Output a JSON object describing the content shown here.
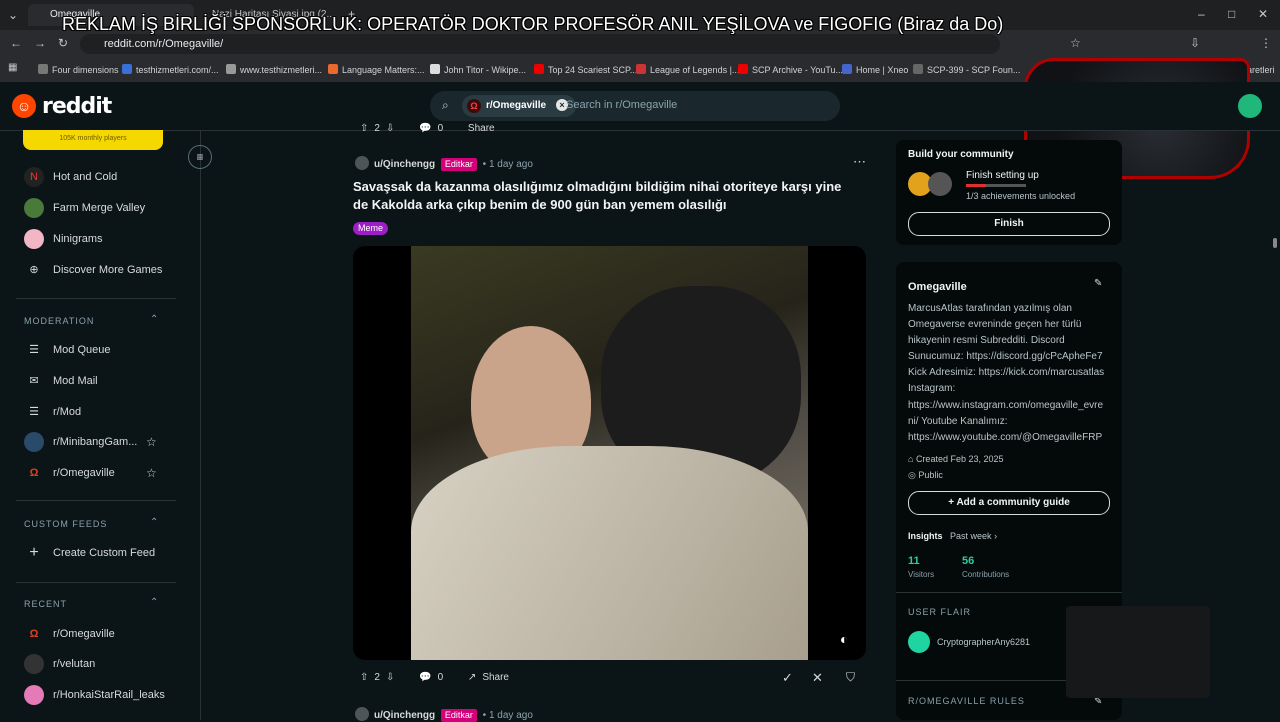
{
  "browser": {
    "tabs": [
      {
        "label": "Omegaville",
        "active": true
      },
      {
        "label": "Nazi Haritası Siyasi.jpg (2...",
        "active": false
      }
    ],
    "overlay_title": "REKLAM İŞ BİRLİĞİ SPONSORLUK: OPERATÖR DOKTOR PROFESÖR ANIL YEŞİLOVA ve FIGOFIG (Biraz da Do)",
    "url": "reddit.com/r/Omegaville/",
    "bookmarks": [
      "Four dimensions",
      "testhizmetleri.com/...",
      "www.testhizmetleri...",
      "Language Matters:...",
      "John Titor - Wikipe...",
      "Top 24 Scariest SCP...",
      "League of Legends |...",
      "SCP Archive - YouTu...",
      "Home | Xneo",
      "SCP-399 - SCP Foun..."
    ],
    "bookmarks_tail": "İşaretleri"
  },
  "header": {
    "logo_text": "reddit",
    "search_chip": "r/Omegaville",
    "search_placeholder": "Search in r/Omegaville"
  },
  "sidebar": {
    "monthly_players": "105K monthly players",
    "games": [
      {
        "label": "Hot and Cold"
      },
      {
        "label": "Farm Merge Valley"
      },
      {
        "label": "Ninigrams"
      },
      {
        "label": "Discover More Games"
      }
    ],
    "moderation_heading": "MODERATION",
    "moderation": [
      {
        "label": "Mod Queue"
      },
      {
        "label": "Mod Mail"
      },
      {
        "label": "r/Mod"
      },
      {
        "label": "r/MinibangGam..."
      },
      {
        "label": "r/Omegaville"
      }
    ],
    "custom_feeds_heading": "CUSTOM FEEDS",
    "create_feed": "Create Custom Feed",
    "recent_heading": "RECENT",
    "recent": [
      {
        "label": "r/Omegaville"
      },
      {
        "label": "r/velutan"
      },
      {
        "label": "r/HonkaiStarRail_leaks"
      }
    ]
  },
  "prev_post_actions": {
    "votes": "2",
    "comments": "0",
    "share": "Share"
  },
  "post": {
    "author": "u/Qinchengg",
    "author_flair": "Editkar",
    "time": "1 day ago",
    "title": "Savaşsak da kazanma olasılığımız olmadığını bildiğim nihai otoriteye karşı yine de Kakolda arka çıkıp benim de 900 gün ban yemem olasılığı",
    "tag": "Meme",
    "votes": "2",
    "comments": "0",
    "share": "Share"
  },
  "next_post": {
    "author": "u/Qinchengg",
    "author_flair": "Editkar",
    "time": "1 day ago"
  },
  "right": {
    "build_heading": "Build your community",
    "setup_title": "Finish setting up",
    "achievements": "1/3 achievements unlocked",
    "finish_button": "Finish",
    "community_name": "Omegaville",
    "description_lines": [
      "MarcusAtlas tarafından yazılmış olan",
      "Omegaverse evreninde geçen her türlü",
      "hikayenin resmi Subredditi. Discord",
      "Sunucumuz: https://discord.gg/cPcAphеFe7",
      "Kick Adresimiz: https://kick.com/marcusatlas",
      "Instagram:",
      "https://www.instagram.com/omegaville_evre",
      "ni/ Youtube Kanalımız:",
      "https://www.youtube.com/@OmegavilleFRP"
    ],
    "created": "Created Feb 23, 2025",
    "visibility": "Public",
    "guide_button": "Add a community guide",
    "insights_label": "Insights",
    "insights_period": "Past week",
    "visitors_num": "11",
    "visitors_label": "Visitors",
    "contrib_num": "56",
    "contrib_label": "Contributions",
    "user_flair_heading": "USER FLAIR",
    "user_flair_name": "CryptographerAny6281",
    "rules_heading": "R/OMEGAVILLE RULES"
  },
  "colors": {
    "accent": "#ff4500",
    "flair_pink": "#d4007a",
    "meme_purple": "#9b1fc4",
    "stat_green": "#2dcc9a"
  }
}
